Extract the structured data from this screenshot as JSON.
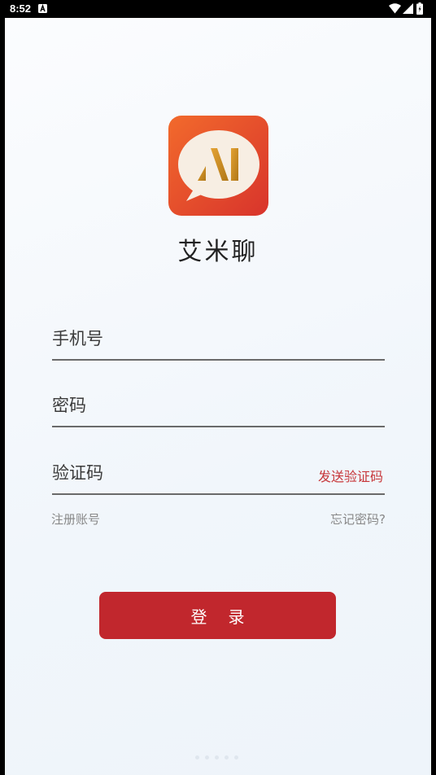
{
  "status_bar": {
    "time": "8:52",
    "notification_icon": "a-letter-icon",
    "wifi_icon": "wifi-icon",
    "signal_icon": "cellular-signal-icon",
    "battery_icon": "battery-icon"
  },
  "app": {
    "logo_icon": "aimi-chat-bubble-logo",
    "name": "艾米聊",
    "brand_color": "#c1272d"
  },
  "form": {
    "phone": {
      "placeholder": "手机号",
      "value": ""
    },
    "password": {
      "placeholder": "密码",
      "value": ""
    },
    "code": {
      "placeholder": "验证码",
      "value": "",
      "send_label": "发送验证码"
    },
    "register_label": "注册账号",
    "forgot_label": "忘记密码?",
    "login_label": "登录"
  },
  "colors": {
    "accent": "#c1272d",
    "link_red": "#c7373a",
    "muted_text": "#888888"
  }
}
